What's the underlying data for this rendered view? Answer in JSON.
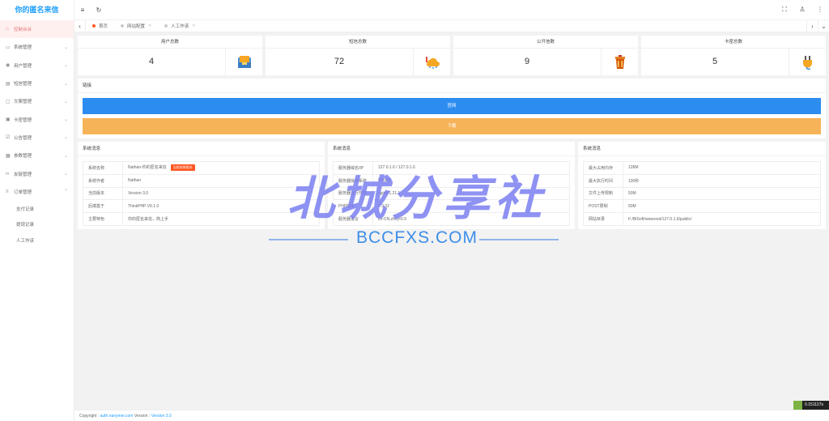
{
  "app": {
    "title": "你的匿名来信"
  },
  "sidebar": {
    "items": [
      {
        "label": "控制台台",
        "icon": "home-icon",
        "active": true
      },
      {
        "label": "系统管理",
        "icon": "monitor-icon"
      },
      {
        "label": "用户管理",
        "icon": "user-icon"
      },
      {
        "label": "短信管理",
        "icon": "message-icon"
      },
      {
        "label": "文案管理",
        "icon": "chat-icon"
      },
      {
        "label": "卡密管理",
        "icon": "card-icon"
      },
      {
        "label": "公告管理",
        "icon": "notice-icon"
      },
      {
        "label": "参数管理",
        "icon": "grid-icon"
      },
      {
        "label": "友链管理",
        "icon": "link-icon"
      },
      {
        "label": "订单管理",
        "icon": "order-icon",
        "expanded": true
      }
    ],
    "subitems": [
      {
        "label": "支付记录"
      },
      {
        "label": "提现记录"
      },
      {
        "label": "人工作该"
      }
    ]
  },
  "tabs": [
    {
      "label": "首页",
      "closable": false
    },
    {
      "label": "网站配置",
      "closable": true
    },
    {
      "label": "人工作该",
      "closable": true
    }
  ],
  "stats": [
    {
      "title": "用户总数",
      "value": "4",
      "icon": "inbox-icon"
    },
    {
      "title": "短信总数",
      "value": "72",
      "icon": "cloud-wrench-icon"
    },
    {
      "title": "公开信数",
      "value": "9",
      "icon": "trash-icon"
    },
    {
      "title": "卡密总数",
      "value": "5",
      "icon": "plug-icon"
    }
  ],
  "links": {
    "title": "链接",
    "official": "官网",
    "download": "下载"
  },
  "info1": {
    "title": "系统消息",
    "rows": [
      {
        "k": "系统名称",
        "v": "Nathan-你的匿名来信",
        "badge": "当前安装版本"
      },
      {
        "k": "系统作者",
        "v": "Nathan"
      },
      {
        "k": "当前版本",
        "v": "Version 3.0"
      },
      {
        "k": "后端基于",
        "v": "ThinkPHP V6.1.0"
      },
      {
        "k": "主要特色",
        "v": "你的匿名来信，简上手"
      }
    ]
  },
  "info2": {
    "title": "系统消息",
    "rows": [
      {
        "k": "服务器域名/IP",
        "v": "127.0.1.6 / 127.0.1.6"
      },
      {
        "k": "服务器操作系统",
        "v": "WINNT"
      },
      {
        "k": "服务器运行环境",
        "v": "nginx/1.21.1"
      },
      {
        "k": "PHP版本",
        "v": "7.3.32"
      },
      {
        "k": "服务器语言",
        "v": "zh-CN,zh;q=0.9"
      }
    ]
  },
  "info3": {
    "title": "系统消息",
    "rows": [
      {
        "k": "最大占用内存",
        "v": "128M"
      },
      {
        "k": "最大执行时间",
        "v": "100秒"
      },
      {
        "k": "文件上传限制",
        "v": "50M"
      },
      {
        "k": "POST限制",
        "v": "50M"
      },
      {
        "k": "网站目录",
        "v": "F:/BtSoft/wwwroot/127.0.1.6/public/"
      }
    ]
  },
  "footer": {
    "copyright": "Copyright :",
    "link": "auth.nanymei.com",
    "version_label": "Version :",
    "version": "Version 3.0"
  },
  "timer": {
    "value": "0.151127s"
  },
  "watermark": {
    "main": "北城分享社",
    "sub": "BCCFXS.COM"
  },
  "colors": {
    "accent": "#1E9FFF",
    "blue_button": "#2d8cf0",
    "orange_button": "#f7b358",
    "badge": "#ff5722"
  }
}
